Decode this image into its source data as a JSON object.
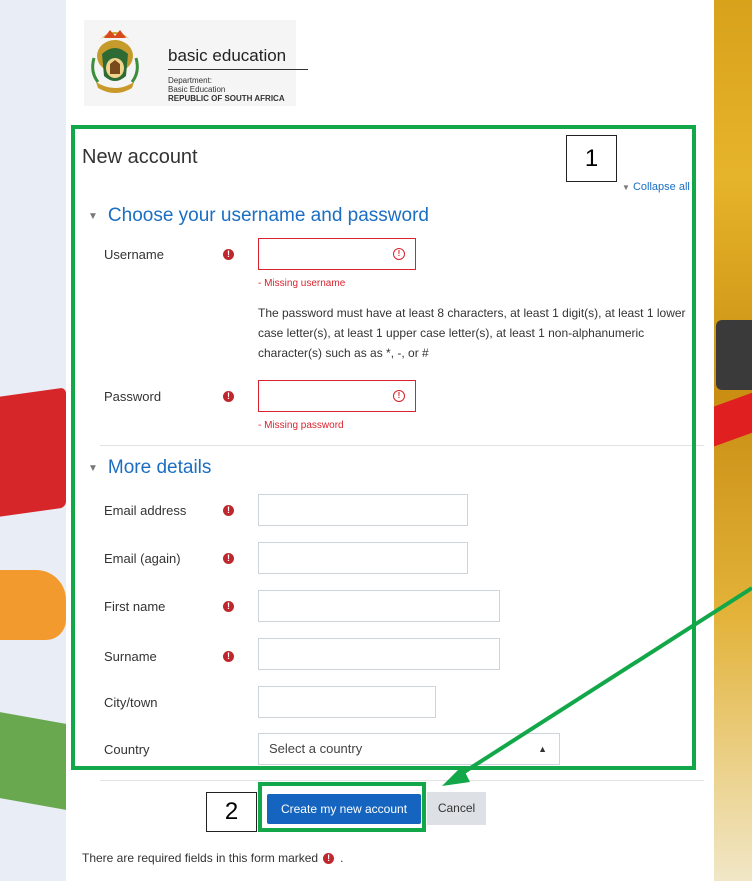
{
  "brand": {
    "title": "basic education",
    "dept_line1": "Department:",
    "dept_line2": "Basic Education",
    "dept_line3": "REPUBLIC OF SOUTH AFRICA"
  },
  "form": {
    "title": "New account",
    "collapse_all": "Collapse all",
    "section1_title": "Choose your username and password",
    "section2_title": "More details",
    "required_icon": "exclamation-circle-icon",
    "fields": {
      "username": {
        "label": "Username",
        "value": "",
        "error": "- Missing username"
      },
      "password_policy": "The password must have at least 8 characters, at least 1 digit(s), at least 1 lower case letter(s), at least 1 upper case letter(s), at least 1 non-alphanumeric character(s) such as as *, -, or #",
      "password": {
        "label": "Password",
        "value": "",
        "error": "- Missing password"
      },
      "email": {
        "label": "Email address",
        "value": ""
      },
      "email_again": {
        "label": "Email (again)",
        "value": ""
      },
      "first_name": {
        "label": "First name",
        "value": ""
      },
      "surname": {
        "label": "Surname",
        "value": ""
      },
      "city": {
        "label": "City/town",
        "value": ""
      },
      "country": {
        "label": "Country",
        "selected": "Select a country"
      }
    },
    "buttons": {
      "create": "Create my new account",
      "cancel": "Cancel"
    },
    "required_note": "There are required fields in this form marked",
    "required_note_end": "."
  },
  "annotations": {
    "label1": "1",
    "label2": "2",
    "color": "#12a84a"
  },
  "colors": {
    "link_blue": "#1b6ec2",
    "primary_button": "#1565c0",
    "error_red": "#d9232e"
  }
}
